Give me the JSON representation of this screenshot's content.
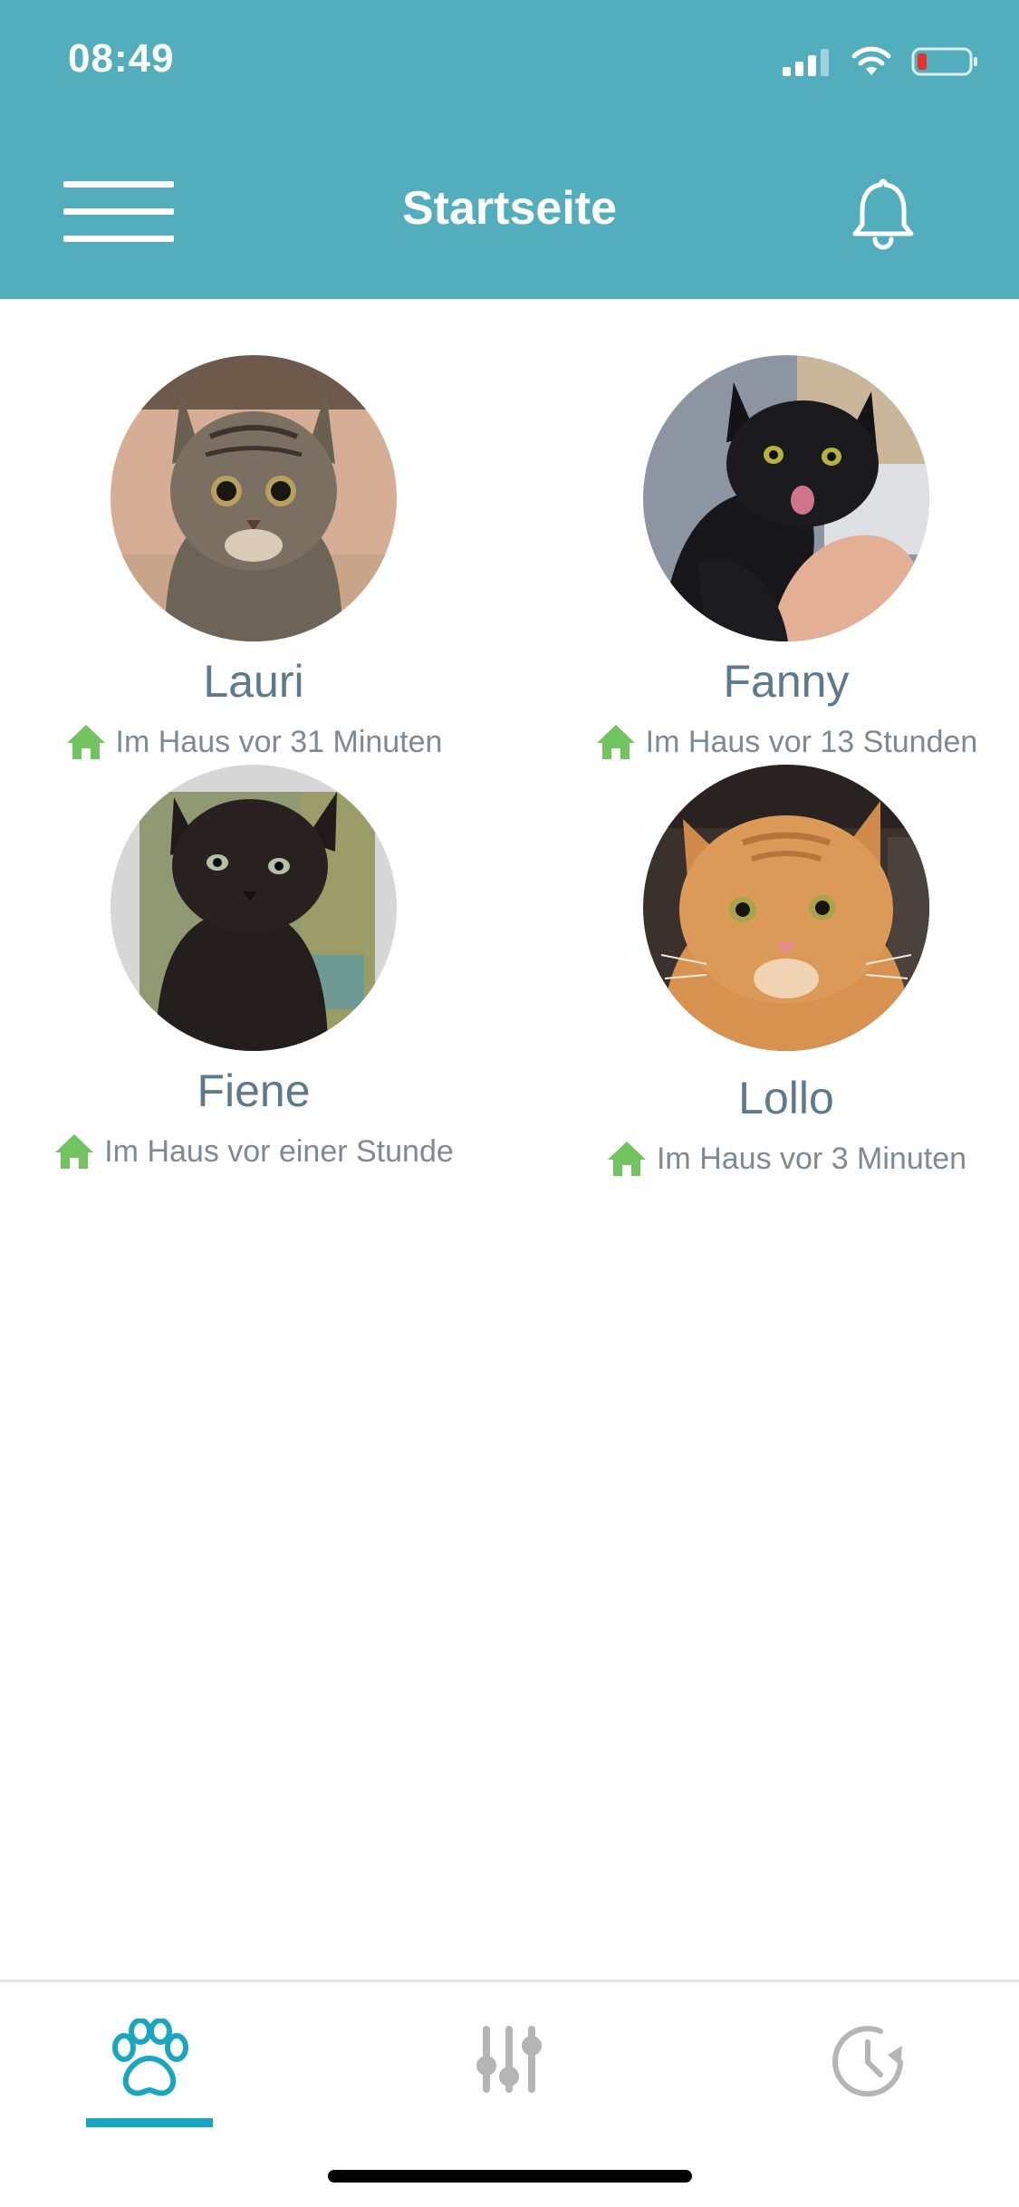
{
  "status_bar": {
    "time": "08:49"
  },
  "header": {
    "title": "Startseite"
  },
  "pets": [
    {
      "name": "Lauri",
      "status": "Im Haus vor 31 Minuten"
    },
    {
      "name": "Fanny",
      "status": "Im Haus vor 13 Stunden"
    },
    {
      "name": "Fiene",
      "status": "Im Haus vor einer Stunde"
    },
    {
      "name": "Lollo",
      "status": "Im Haus vor 3 Minuten"
    }
  ],
  "icons": {
    "menu": "hamburger-menu-icon",
    "notifications": "bell-icon",
    "status": "house-icon",
    "tabs": [
      "paw-icon",
      "sliders-icon",
      "history-icon"
    ]
  },
  "colors": {
    "header_bg": "#52adbd",
    "accent": "#1aa6bf",
    "status_green": "#72c461",
    "name_text": "#5c7a8c",
    "inactive_tab": "#b5b5b5",
    "battery_low": "#e8312d"
  },
  "tab_bar": {
    "active_index": 0
  }
}
